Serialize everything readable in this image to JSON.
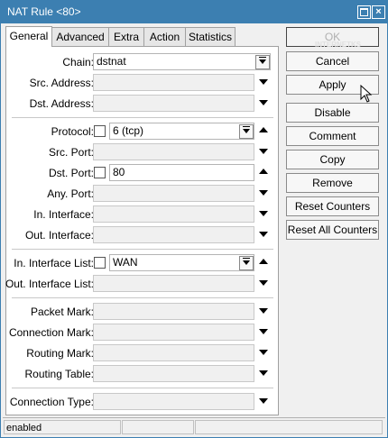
{
  "window": {
    "title": "NAT Rule <80>"
  },
  "tabs": [
    "General",
    "Advanced",
    "Extra",
    "Action",
    "Statistics"
  ],
  "form": {
    "chain": {
      "label": "Chain:",
      "value": "dstnat"
    },
    "src_address": {
      "label": "Src. Address:"
    },
    "dst_address": {
      "label": "Dst. Address:"
    },
    "protocol": {
      "label": "Protocol:",
      "value": "6 (tcp)"
    },
    "src_port": {
      "label": "Src. Port:"
    },
    "dst_port": {
      "label": "Dst. Port:",
      "value": "80"
    },
    "any_port": {
      "label": "Any. Port:"
    },
    "in_interface": {
      "label": "In. Interface:"
    },
    "out_interface": {
      "label": "Out. Interface:"
    },
    "in_interface_list": {
      "label": "In. Interface List:",
      "value": "WAN"
    },
    "out_interface_list": {
      "label": "Out. Interface List:"
    },
    "packet_mark": {
      "label": "Packet Mark:"
    },
    "connection_mark": {
      "label": "Connection Mark:"
    },
    "routing_mark": {
      "label": "Routing Mark:"
    },
    "routing_table": {
      "label": "Routing Table:"
    },
    "connection_type": {
      "label": "Connection Type:"
    }
  },
  "buttons": {
    "ok": "OK",
    "cancel": "Cancel",
    "apply": "Apply",
    "disable": "Disable",
    "comment": "Comment",
    "copy": "Copy",
    "remove": "Remove",
    "reset_counters": "Reset Counters",
    "reset_all_counters": "Reset All Counters"
  },
  "watermark": "INTERNETKS",
  "status": {
    "text": "enabled"
  },
  "colors": {
    "titlebar": "#3c7fb1"
  }
}
